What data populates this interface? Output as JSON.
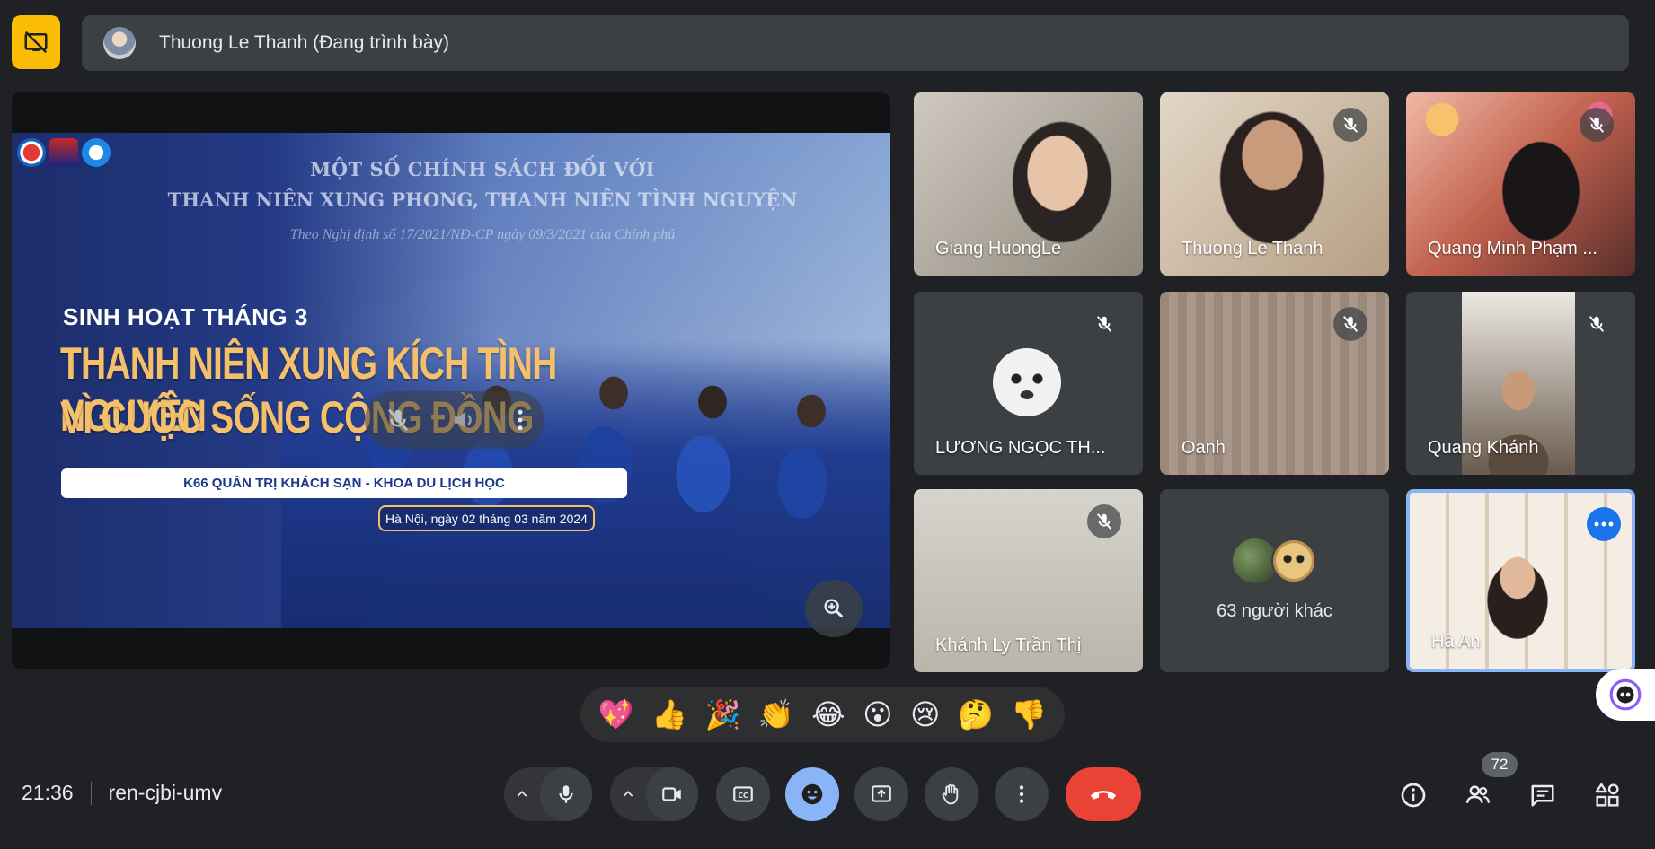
{
  "presenter": {
    "banner_text": "Thuong Le Thanh (Đang trình bày)"
  },
  "slide": {
    "heading_1": "MỘT SỐ CHÍNH SÁCH ĐỐI VỚI",
    "heading_2": "THANH NIÊN XUNG PHONG, THANH NIÊN TÌNH NGUYỆN",
    "decree": "Theo Nghị định số 17/2021/NĐ-CP ngày 09/3/2021 của Chính phủ",
    "subtitle": "SINH HOẠT THÁNG 3",
    "title_line_1": "THANH NIÊN XUNG KÍCH TÌNH NGUYỆN",
    "title_line_2": "VÌ CUỘC SỐNG CỘNG ĐỒNG",
    "band": "K66 QUẢN TRỊ KHÁCH SẠN - KHOA DU LỊCH HỌC",
    "date": "Hà Nội, ngày 02 tháng 03 năm 2024"
  },
  "participants": [
    {
      "name": "Giang HuongLe",
      "muted": false
    },
    {
      "name": "Thuong Le Thanh",
      "muted": true
    },
    {
      "name": "Quang Minh Phạm ...",
      "muted": true
    },
    {
      "name": "LƯƠNG NGỌC TH...",
      "muted": true
    },
    {
      "name": "Oanh",
      "muted": true
    },
    {
      "name": "Quang Khánh",
      "muted": true
    },
    {
      "name": "Khánh Ly Trần Thị",
      "muted": true
    },
    {
      "name": "63 người khác",
      "muted": false
    },
    {
      "name": "Hà An",
      "muted": false
    }
  ],
  "reactions": [
    "💖",
    "👍",
    "🎉",
    "👏",
    "😂",
    "😮",
    "😢",
    "🤔",
    "👎"
  ],
  "meeting": {
    "time": "21:36",
    "code": "ren-cjbi-umv",
    "participant_count": "72"
  },
  "colors": {
    "background": "#202124",
    "surface": "#3c4043",
    "present_accent": "#fbbc04",
    "active_border": "#8ab4f8",
    "end_call": "#ea4335",
    "slide_title": "#f4c069"
  }
}
